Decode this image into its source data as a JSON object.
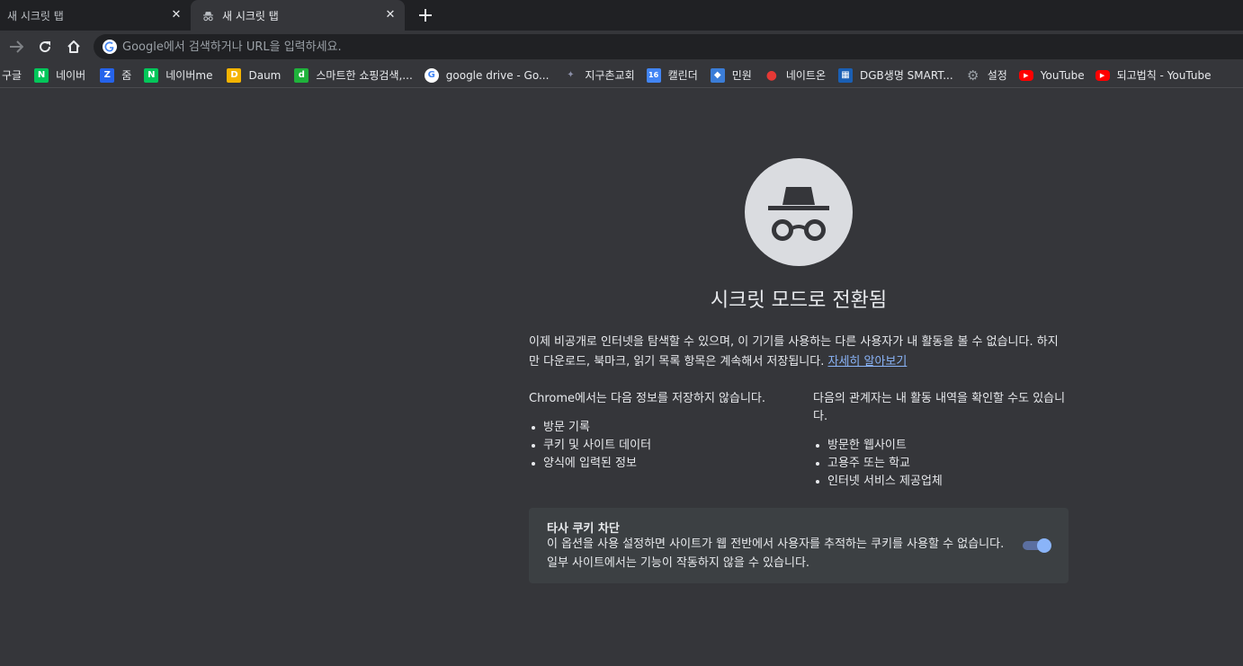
{
  "tabs": [
    {
      "title": "새 시크릿 탭",
      "active": false
    },
    {
      "title": "새 시크릿 탭",
      "active": true
    }
  ],
  "icons": {
    "close": "close-icon",
    "new_tab": "plus-icon",
    "back": "arrow-left-icon",
    "reload": "reload-icon",
    "home": "home-icon",
    "incognito": "incognito-icon"
  },
  "omnibox": {
    "placeholder": "Google에서 검색하거나 URL을 입력하세요."
  },
  "bookmarks": [
    {
      "label": "구글",
      "icon": "none"
    },
    {
      "label": "네이버",
      "icon": "naver-icon",
      "color": "#03c75a",
      "glyph": "N"
    },
    {
      "label": "줌",
      "icon": "zum-icon",
      "color": "#2563eb",
      "glyph": "Z"
    },
    {
      "label": "네이버me",
      "icon": "naver-icon",
      "color": "#03c75a",
      "glyph": "N"
    },
    {
      "label": "Daum",
      "icon": "daum-icon",
      "color": "#f5b400",
      "glyph": "D"
    },
    {
      "label": "스마트한 쇼핑검색,...",
      "icon": "danawa-icon",
      "color": "#1fb33b",
      "glyph": "d"
    },
    {
      "label": "google drive - Go...",
      "icon": "google-icon",
      "color": "#ffffff",
      "glyph": "G"
    },
    {
      "label": "지구촌교회",
      "icon": "church-icon",
      "color": "#8b8fa8",
      "glyph": "✦"
    },
    {
      "label": "캘린더",
      "icon": "calendar-icon",
      "color": "#4285f4",
      "glyph": "16"
    },
    {
      "label": "민원",
      "icon": "minwon-icon",
      "color": "#3b7dd8",
      "glyph": "◆"
    },
    {
      "label": "네이트온",
      "icon": "nateon-icon",
      "color": "#e53935",
      "glyph": "●"
    },
    {
      "label": "DGB생명 SMART...",
      "icon": "dgb-icon",
      "color": "#1a5fb4",
      "glyph": "▦"
    },
    {
      "label": "설정",
      "icon": "gear-icon",
      "color": "#9aa0a6",
      "glyph": "⚙"
    },
    {
      "label": "YouTube",
      "icon": "youtube-icon",
      "color": "#ff0000",
      "glyph": "▶"
    },
    {
      "label": "되고법칙 - YouTube",
      "icon": "youtube-icon",
      "color": "#ff0000",
      "glyph": "▶"
    }
  ],
  "main": {
    "heading": "시크릿 모드로 전환됨",
    "intro_text": "이제 비공개로 인터넷을 탐색할 수 있으며, 이 기기를 사용하는 다른 사용자가 내 활동을 볼 수 없습니다. 하지만 다운로드, 북마크, 읽기 목록 항목은 계속해서 저장됩니다. ",
    "learn_more": "자세히 알아보기",
    "left_column": {
      "heading": "Chrome에서는 다음 정보를 저장하지 않습니다.",
      "items": [
        "방문 기록",
        "쿠키 및 사이트 데이터",
        "양식에 입력된 정보"
      ]
    },
    "right_column": {
      "heading": "다음의 관계자는 내 활동 내역을 확인할 수도 있습니다.",
      "items": [
        "방문한 웹사이트",
        "고용주 또는 학교",
        "인터넷 서비스 제공업체"
      ]
    },
    "cookie_card": {
      "title": "타사 쿠키 차단",
      "description": "이 옵션을 사용 설정하면 사이트가 웹 전반에서 사용자를 추적하는 쿠키를 사용할 수 없습니다. 일부 사이트에서는 기능이 작동하지 않을 수 있습니다.",
      "toggle_on": true
    }
  },
  "colors": {
    "background": "#35363a",
    "tabstrip": "#202124",
    "link": "#8ab4f8",
    "toggle_knob": "#8ab4f8"
  }
}
